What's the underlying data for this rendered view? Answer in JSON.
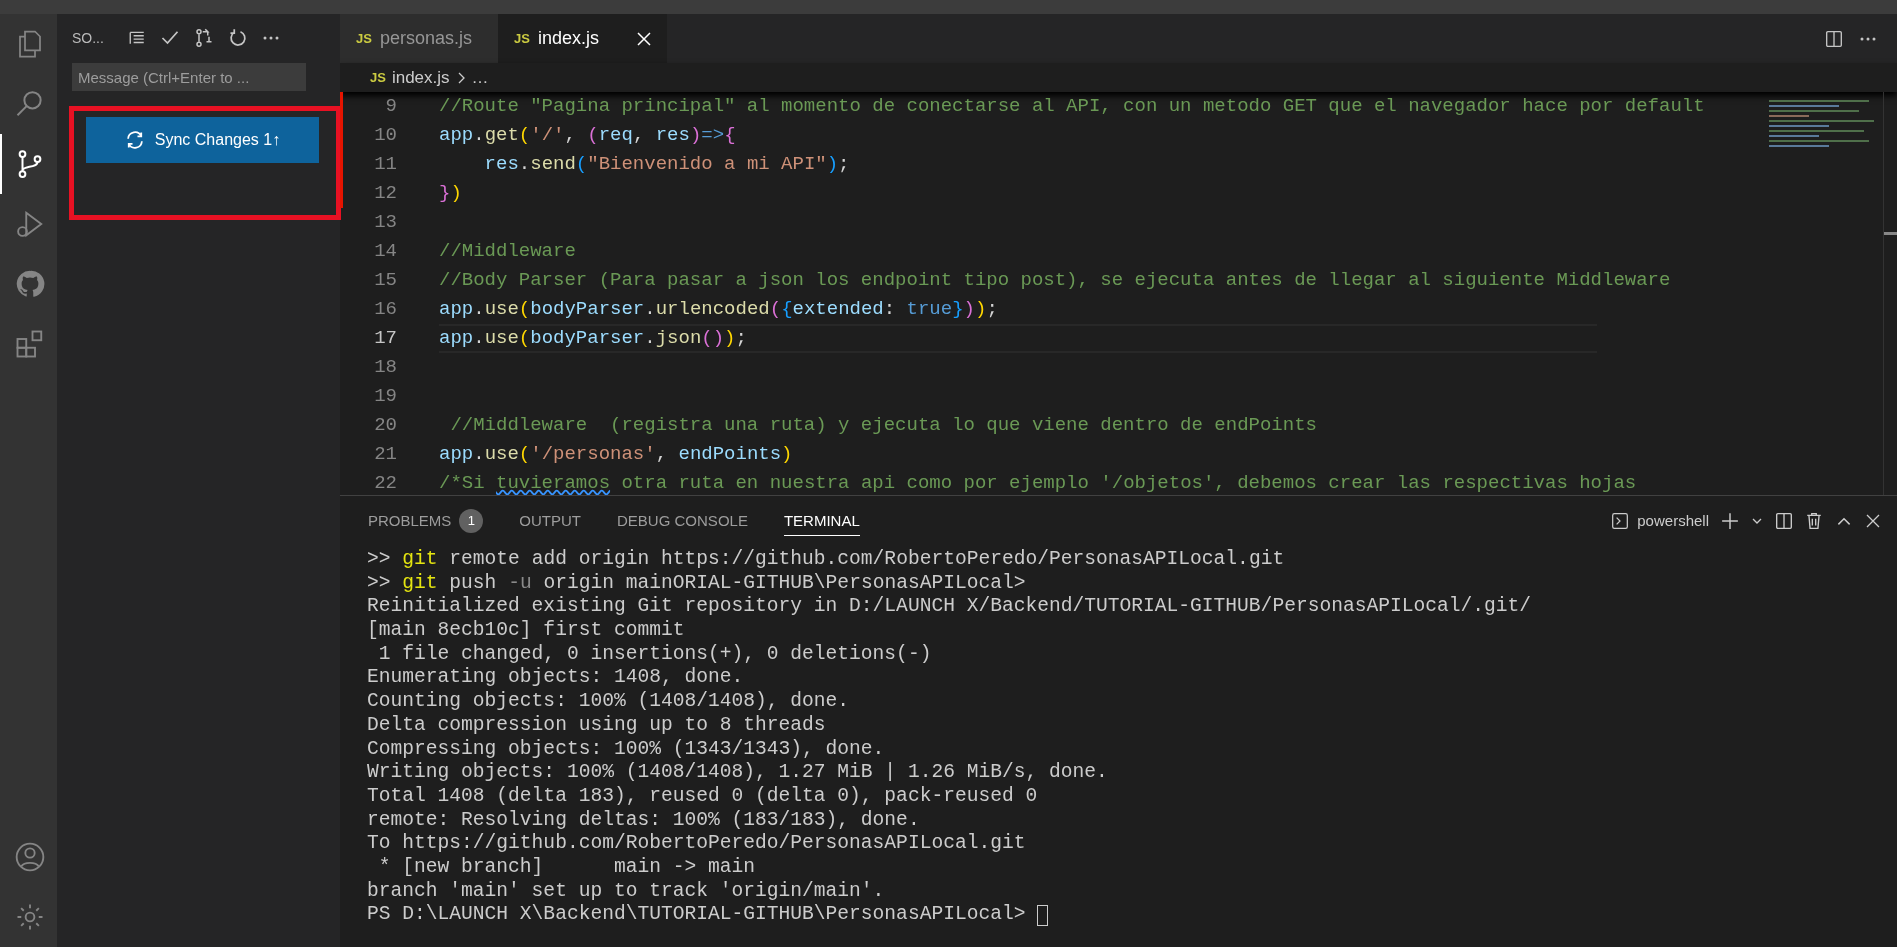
{
  "activity_bar": {
    "top": [
      {
        "kind": "files",
        "selected": false
      },
      {
        "kind": "search",
        "selected": false
      },
      {
        "kind": "source-control",
        "selected": true
      },
      {
        "kind": "run",
        "selected": false
      },
      {
        "kind": "github",
        "selected": false
      },
      {
        "kind": "extensions",
        "selected": false
      }
    ],
    "bottom": [
      {
        "kind": "account",
        "selected": false
      },
      {
        "kind": "settings",
        "selected": false
      }
    ]
  },
  "sidebar": {
    "title": "SO...",
    "message": {
      "placeholder": "Message (Ctrl+Enter to ..."
    },
    "sync_button": "Sync Changes 1↑"
  },
  "tabs": [
    {
      "icon_text": "JS",
      "label": "personas.js",
      "selected": false
    },
    {
      "icon_text": "JS",
      "label": "index.js",
      "selected": true
    }
  ],
  "breadcrumb": {
    "icon_text": "JS",
    "file": "index.js",
    "more": "…"
  },
  "editor": {
    "lines": [
      {
        "number": "9",
        "current": false,
        "changed": true,
        "tokens": [
          {
            "t": "//Route \"Pagina principal\" al momento de conectarse al API, con un metodo GET que el navegador hace por default",
            "kind": "comment"
          }
        ]
      },
      {
        "number": "10",
        "current": false,
        "changed": true,
        "tokens": [
          {
            "t": "app",
            "kind": "variable"
          },
          {
            "t": ".",
            "kind": "punct"
          },
          {
            "t": "get",
            "kind": "function"
          },
          {
            "t": "(",
            "kind": "bracket1"
          },
          {
            "t": "'/'",
            "kind": "string"
          },
          {
            "t": ", ",
            "kind": "punct"
          },
          {
            "t": "(",
            "kind": "bracket2"
          },
          {
            "t": "req",
            "kind": "variable"
          },
          {
            "t": ", ",
            "kind": "punct"
          },
          {
            "t": "res",
            "kind": "variable"
          },
          {
            "t": ")",
            "kind": "bracket2"
          },
          {
            "t": "=>",
            "kind": "keyword"
          },
          {
            "t": "{",
            "kind": "bracket2"
          }
        ]
      },
      {
        "number": "11",
        "current": false,
        "changed": true,
        "tokens": [
          {
            "t": "    res",
            "kind": "variable"
          },
          {
            "t": ".",
            "kind": "punct"
          },
          {
            "t": "send",
            "kind": "function"
          },
          {
            "t": "(",
            "kind": "bracket3"
          },
          {
            "t": "\"Bienvenido a mi API\"",
            "kind": "string"
          },
          {
            "t": ")",
            "kind": "bracket3"
          },
          {
            "t": ";",
            "kind": "punct"
          }
        ]
      },
      {
        "number": "12",
        "current": false,
        "changed": true,
        "tokens": [
          {
            "t": "}",
            "kind": "bracket2"
          },
          {
            "t": ")",
            "kind": "bracket1"
          }
        ]
      },
      {
        "number": "13",
        "current": false,
        "changed": false
      },
      {
        "number": "14",
        "current": false,
        "changed": false,
        "tokens": [
          {
            "t": "//Middleware",
            "kind": "comment"
          }
        ]
      },
      {
        "number": "15",
        "current": false,
        "changed": false,
        "tokens": [
          {
            "t": "//Body Parser (Para pasar a json los endpoint tipo post), se ejecuta antes de llegar al siguiente Middleware",
            "kind": "comment"
          }
        ]
      },
      {
        "number": "16",
        "current": false,
        "changed": false,
        "tokens": [
          {
            "t": "app",
            "kind": "variable"
          },
          {
            "t": ".",
            "kind": "punct"
          },
          {
            "t": "use",
            "kind": "function"
          },
          {
            "t": "(",
            "kind": "bracket1"
          },
          {
            "t": "bodyParser",
            "kind": "variable"
          },
          {
            "t": ".",
            "kind": "punct"
          },
          {
            "t": "urlencoded",
            "kind": "function"
          },
          {
            "t": "(",
            "kind": "bracket2"
          },
          {
            "t": "{",
            "kind": "bracket3"
          },
          {
            "t": "extended",
            "kind": "variable"
          },
          {
            "t": ": ",
            "kind": "punct"
          },
          {
            "t": "true",
            "kind": "keyword"
          },
          {
            "t": "}",
            "kind": "bracket3"
          },
          {
            "t": ")",
            "kind": "bracket2"
          },
          {
            "t": ")",
            "kind": "bracket1"
          },
          {
            "t": ";",
            "kind": "punct"
          }
        ]
      },
      {
        "number": "17",
        "current": true,
        "changed": false,
        "tokens": [
          {
            "t": "app",
            "kind": "variable"
          },
          {
            "t": ".",
            "kind": "punct"
          },
          {
            "t": "use",
            "kind": "function"
          },
          {
            "t": "(",
            "kind": "bracket1"
          },
          {
            "t": "bodyParser",
            "kind": "variable"
          },
          {
            "t": ".",
            "kind": "punct"
          },
          {
            "t": "json",
            "kind": "function"
          },
          {
            "t": "(",
            "kind": "bracket2"
          },
          {
            "t": ")",
            "kind": "bracket2"
          },
          {
            "t": ")",
            "kind": "bracket1"
          },
          {
            "t": ";",
            "kind": "punct"
          }
        ]
      },
      {
        "number": "18",
        "current": false,
        "changed": false
      },
      {
        "number": "19",
        "current": false,
        "changed": false
      },
      {
        "number": "20",
        "current": false,
        "changed": false,
        "tokens": [
          {
            "t": " //Middleware  (registra una ruta) y ejecuta lo que viene dentro de endPoints",
            "kind": "comment"
          }
        ]
      },
      {
        "number": "21",
        "current": false,
        "changed": false,
        "tokens": [
          {
            "t": "app",
            "kind": "variable"
          },
          {
            "t": ".",
            "kind": "punct"
          },
          {
            "t": "use",
            "kind": "function"
          },
          {
            "t": "(",
            "kind": "bracket1"
          },
          {
            "t": "'/personas'",
            "kind": "string"
          },
          {
            "t": ", ",
            "kind": "punct"
          },
          {
            "t": "endPoints",
            "kind": "variable"
          },
          {
            "t": ")",
            "kind": "bracket1"
          }
        ]
      },
      {
        "number": "22",
        "current": false,
        "changed": false,
        "tokens": [
          {
            "t": "/*Si ",
            "kind": "comment"
          },
          {
            "t": "tuvieramos",
            "kind": "misspelled"
          },
          {
            "t": " otra ruta en nuestra api como por ejemplo '/objetos', debemos crear las respectivas hojas",
            "kind": "comment"
          }
        ]
      }
    ]
  },
  "panel": {
    "tabs": [
      {
        "label": "PROBLEMS",
        "badge": "1",
        "selected": false
      },
      {
        "label": "OUTPUT",
        "selected": false
      },
      {
        "label": "DEBUG CONSOLE",
        "selected": false
      },
      {
        "label": "TERMINAL",
        "selected": true
      }
    ],
    "terminal_name": "powershell",
    "cursor": true,
    "lines": [
      [
        {
          "t": ">> ",
          "kind": "output"
        },
        {
          "t": "git",
          "kind": "command"
        },
        {
          "t": " remote add origin https://github.com/RobertoPeredo/PersonasAPILocal.git",
          "kind": "output"
        }
      ],
      [
        {
          "t": ">> ",
          "kind": "output"
        },
        {
          "t": "git",
          "kind": "command"
        },
        {
          "t": " push ",
          "kind": "output"
        },
        {
          "t": "-u",
          "kind": "flag"
        },
        {
          "t": " origin mainORIAL-GITHUB\\PersonasAPILocal>",
          "kind": "output"
        }
      ],
      [
        {
          "t": "Reinitialized existing Git repository in D:/LAUNCH X/Backend/TUTORIAL-GITHUB/PersonasAPILocal/.git/",
          "kind": "output"
        }
      ],
      [
        {
          "t": "[main 8ecb10c] first commit",
          "kind": "output"
        }
      ],
      [
        {
          "t": " 1 file changed, 0 insertions(+), 0 deletions(-)",
          "kind": "output"
        }
      ],
      [
        {
          "t": "Enumerating objects: 1408, done.",
          "kind": "output"
        }
      ],
      [
        {
          "t": "Counting objects: 100% (1408/1408), done.",
          "kind": "output"
        }
      ],
      [
        {
          "t": "Delta compression using up to 8 threads",
          "kind": "output"
        }
      ],
      [
        {
          "t": "Compressing objects: 100% (1343/1343), done.",
          "kind": "output"
        }
      ],
      [
        {
          "t": "Writing objects: 100% (1408/1408), 1.27 MiB | 1.26 MiB/s, done.",
          "kind": "output"
        }
      ],
      [
        {
          "t": "Total 1408 (delta 183), reused 0 (delta 0), pack-reused 0",
          "kind": "output"
        }
      ],
      [
        {
          "t": "remote: Resolving deltas: 100% (183/183), done.",
          "kind": "output"
        }
      ],
      [
        {
          "t": "To https://github.com/RobertoPeredo/PersonasAPILocal.git",
          "kind": "output"
        }
      ],
      [
        {
          "t": " * [new branch]      main -> main",
          "kind": "output"
        }
      ],
      [
        {
          "t": "branch 'main' set up to track 'origin/main'.",
          "kind": "output"
        }
      ],
      [
        {
          "t": "PS D:\\LAUNCH X\\Backend\\TUTORIAL-GITHUB\\PersonasAPILocal> ",
          "kind": "output"
        }
      ]
    ]
  }
}
